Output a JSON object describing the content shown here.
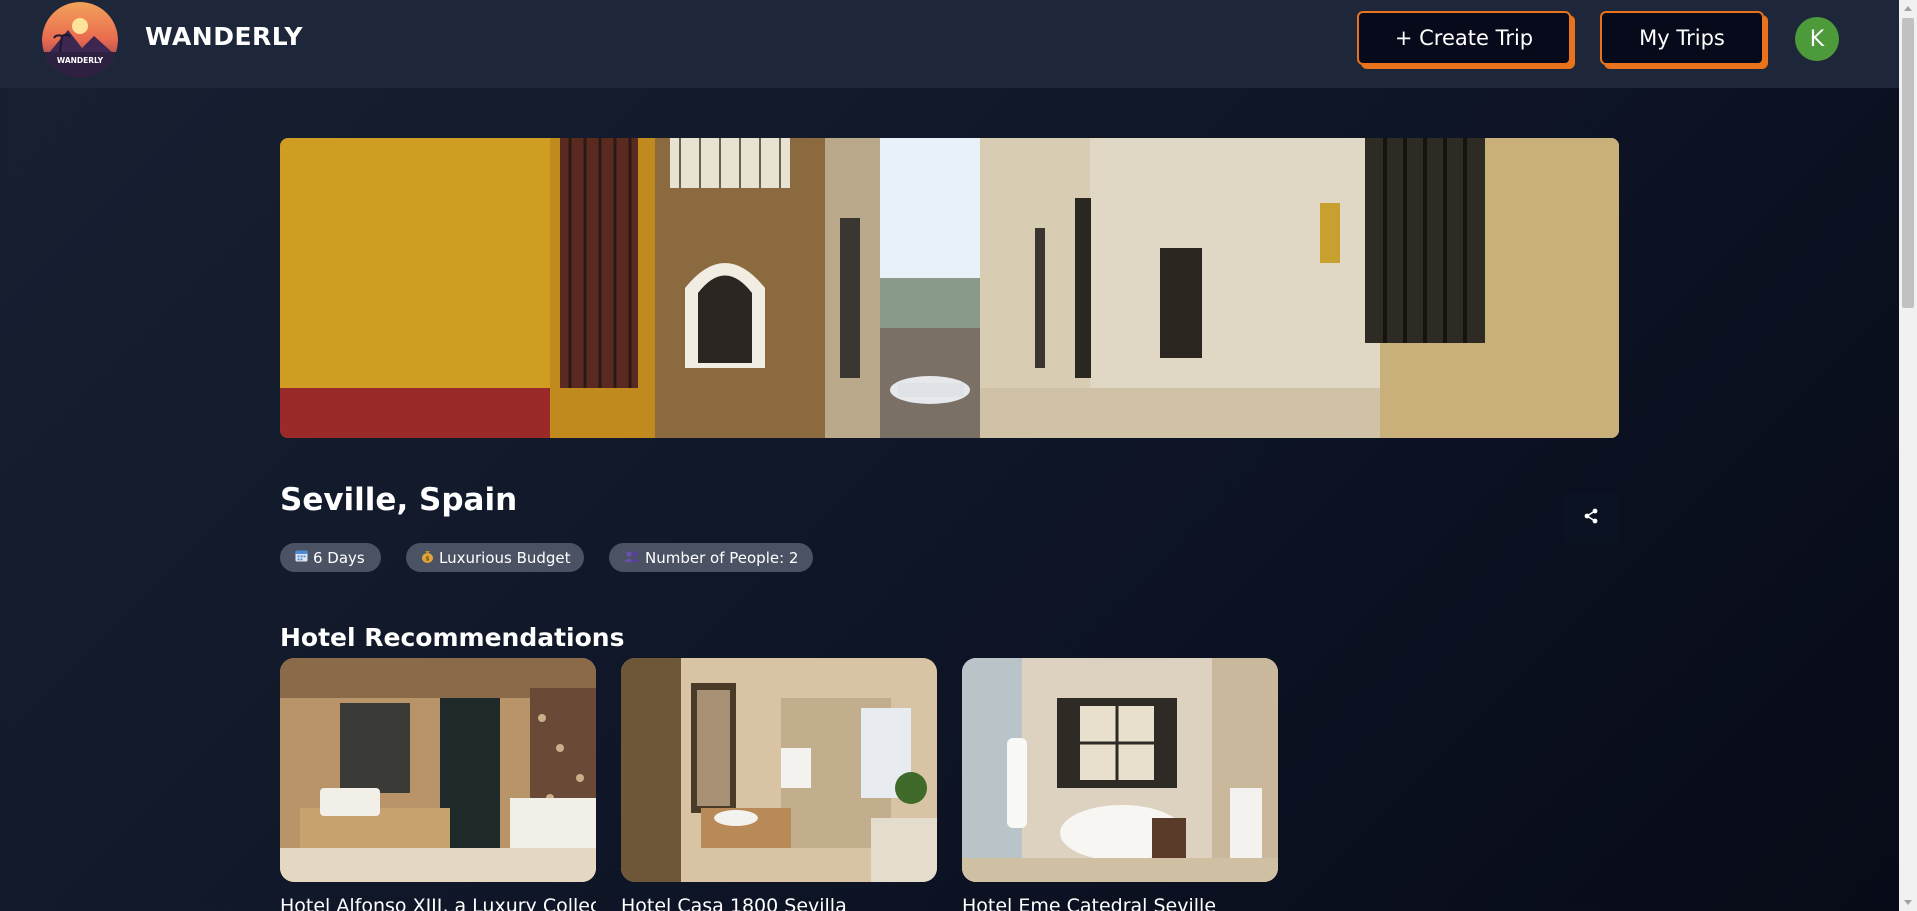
{
  "header": {
    "brand": "WANDERLY",
    "logo_text": "WANDERLY",
    "create_trip_label": "+ Create Trip",
    "my_trips_label": "My Trips",
    "avatar_initial": "K"
  },
  "trip": {
    "title": "Seville, Spain",
    "chips": [
      {
        "icon": "calendar-icon",
        "label": "6 Days"
      },
      {
        "icon": "money-bag-icon",
        "label": "Luxurious Budget"
      },
      {
        "icon": "people-icon",
        "label": "Number of People: 2"
      }
    ],
    "share_icon": "share-icon"
  },
  "hotels": {
    "section_title": "Hotel Recommendations",
    "items": [
      {
        "name": "Hotel Alfonso XIII, a Luxury Collection Hotel"
      },
      {
        "name": "Hotel Casa 1800 Sevilla"
      },
      {
        "name": "Hotel Eme Catedral Seville"
      }
    ]
  },
  "colors": {
    "accent": "#e8731c",
    "header_bg": "#1e2739",
    "chip_bg": "#4b5263",
    "avatar_bg": "#4c9a3a"
  }
}
